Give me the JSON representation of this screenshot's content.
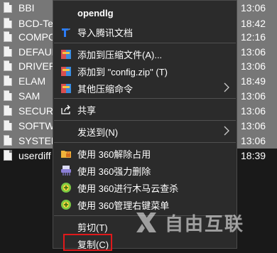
{
  "file_list": {
    "rows": [
      {
        "name": "BBI",
        "time": "13:06"
      },
      {
        "name": "BCD-Template",
        "time": "18:42"
      },
      {
        "name": "COMPONENTS",
        "time": "12:16"
      },
      {
        "name": "DEFAULT",
        "time": "13:06"
      },
      {
        "name": "DRIVERS",
        "time": "13:06"
      },
      {
        "name": "ELAM",
        "time": "18:49"
      },
      {
        "name": "SAM",
        "time": "13:06"
      },
      {
        "name": "SECURITY",
        "time": "13:06"
      },
      {
        "name": "SOFTWARE",
        "time": "13:06"
      },
      {
        "name": "SYSTEM",
        "time": "13:06"
      },
      {
        "name": "userdiff",
        "time": "18:39"
      }
    ]
  },
  "context_menu": {
    "header": "opendlg",
    "items": {
      "tencent_docs": "导入腾讯文档",
      "add_archive": "添加到压缩文件(A)...",
      "add_zip": "添加到 \"config.zip\" (T)",
      "other_compress": "其他压缩命令",
      "share": "共享",
      "send_to": "发送到(N)",
      "unlock_360": "使用 360解除占用",
      "force_delete_360": "使用 360强力删除",
      "trojan_scan_360": "使用 360进行木马云查杀",
      "manage_menu_360": "使用 360管理右键菜单",
      "cut": "剪切(T)",
      "copy": "复制(C)"
    }
  },
  "watermark": {
    "text": "自由互联"
  },
  "colors": {
    "selected_row": "#777777",
    "menu_bg": "#2b2b2b",
    "highlight": "#e0191b"
  }
}
